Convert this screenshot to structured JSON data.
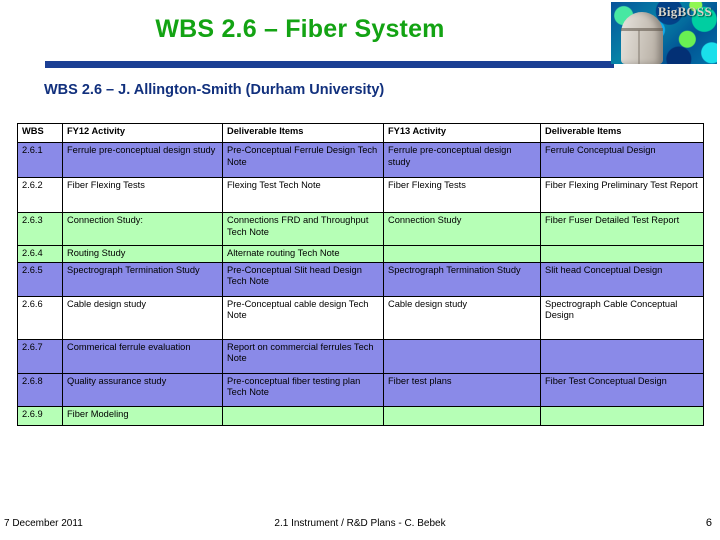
{
  "slide": {
    "title": "WBS 2.6 – Fiber System",
    "subtitle": "WBS 2.6 – J. Allington-Smith (Durham University)",
    "title_color": "#13a313",
    "subtitle_color": "#11307d",
    "rule_color": "#1b3f94"
  },
  "logo": {
    "text": "BigBOSS",
    "alt": "bigboss-telescope-dome-logo"
  },
  "table": {
    "headers": [
      "WBS",
      "FY12 Activity",
      "Deliverable Items",
      "FY13 Activity",
      "Deliverable Items"
    ],
    "row_colors": {
      "blue": "#8a8ae8",
      "green": "#b6ffb6",
      "white": "#ffffff"
    },
    "rows": [
      {
        "wbs": "2.6.1",
        "fy12": "Ferrule pre-conceptual design study",
        "del1": "Pre-Conceptual Ferrule Design Tech Note",
        "fy13": "Ferrule pre-conceptual design study",
        "del2": "Ferrule Conceptual Design",
        "color": "blue"
      },
      {
        "wbs": "2.6.2",
        "fy12": "Fiber Flexing Tests",
        "del1": "Flexing Test Tech Note",
        "fy13": "Fiber Flexing Tests",
        "del2": "Fiber Flexing Preliminary Test Report",
        "color": "white"
      },
      {
        "wbs": "2.6.3",
        "fy12": "Connection Study:",
        "del1": "Connections FRD and Throughput Tech Note",
        "fy13": "Connection Study",
        "del2": "Fiber Fuser Detailed Test Report",
        "color": "green"
      },
      {
        "wbs": "2.6.4",
        "fy12": "Routing Study",
        "del1": "Alternate routing Tech Note",
        "fy13": "",
        "del2": "",
        "color": "green"
      },
      {
        "wbs": "2.6.5",
        "fy12": "Spectrograph Termination Study",
        "del1": "Pre-Conceptual Slit head Design Tech Note",
        "fy13": "Spectrograph Termination Study",
        "del2": "Slit head Conceptual Design",
        "color": "blue"
      },
      {
        "wbs": "2.6.6",
        "fy12": "Cable design study",
        "del1": "Pre-Conceptual cable design Tech Note",
        "fy13": "Cable design study",
        "del2": "Spectrograph Cable Conceptual Design",
        "color": "white"
      },
      {
        "wbs": "2.6.7",
        "fy12": "Commerical ferrule evaluation",
        "del1": "Report on commercial ferrules Tech Note",
        "fy13": "",
        "del2": "",
        "color": "blue"
      },
      {
        "wbs": "2.6.8",
        "fy12": "Quality assurance study",
        "del1": "Pre-conceptual fiber testing plan Tech Note",
        "fy13": "Fiber test plans",
        "del2": "Fiber Test Conceptual Design",
        "color": "blue"
      },
      {
        "wbs": "2.6.9",
        "fy12": "Fiber Modeling",
        "del1": "",
        "fy13": "",
        "del2": "",
        "color": "green"
      }
    ]
  },
  "footer": {
    "date": "7 December 2011",
    "center": "2.1  Instrument / R&D Plans - C. Bebek",
    "page": "6"
  }
}
